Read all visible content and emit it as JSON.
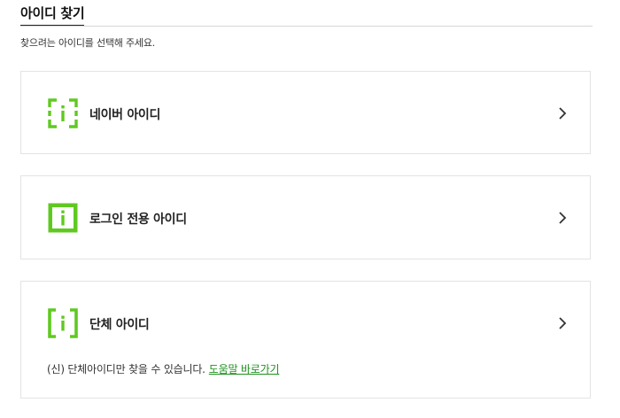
{
  "page": {
    "title": "아이디 찾기",
    "subtitle": "찾으려는 아이디를 선택해 주세요."
  },
  "cards": [
    {
      "label": "네이버 아이디",
      "icon": "dashed-info-icon"
    },
    {
      "label": "로그인 전용 아이디",
      "icon": "solid-info-icon"
    },
    {
      "label": "단체 아이디",
      "icon": "bracket-info-icon"
    }
  ],
  "group_note": {
    "text": "(신) 단체아이디만 찾을 수 있습니다.",
    "link_label": "도움말 바로가기"
  },
  "colors": {
    "accent_green": "#5fc920",
    "link_green": "#1e8f1e"
  }
}
